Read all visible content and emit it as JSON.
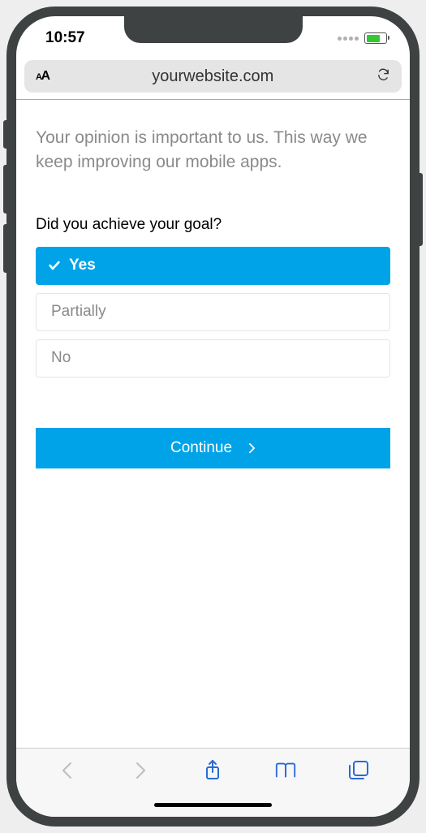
{
  "status": {
    "time": "10:57"
  },
  "browser": {
    "url": "yourwebsite.com"
  },
  "survey": {
    "intro": "Your opinion is important to us. This way we keep improving our mobile apps.",
    "question": "Did you achieve your goal?",
    "options": [
      {
        "label": "Yes",
        "selected": true
      },
      {
        "label": "Partially",
        "selected": false
      },
      {
        "label": "No",
        "selected": false
      }
    ],
    "continue_label": "Continue"
  },
  "colors": {
    "accent": "#00a3e8"
  }
}
